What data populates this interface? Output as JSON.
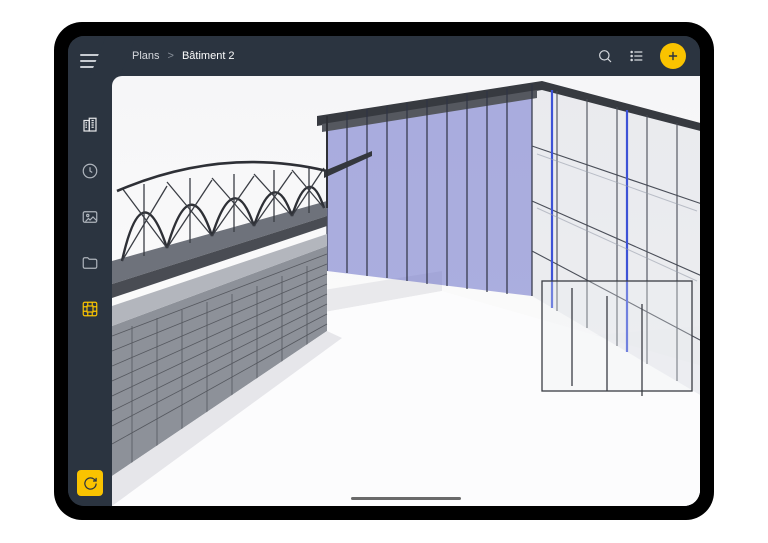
{
  "breadcrumb": {
    "root": "Plans",
    "separator": ">",
    "current": "Bâtiment 2"
  },
  "sidebar": {
    "items": [
      {
        "name": "buildings"
      },
      {
        "name": "history"
      },
      {
        "name": "photos"
      },
      {
        "name": "files"
      },
      {
        "name": "bim"
      }
    ]
  },
  "colors": {
    "accent": "#fac300",
    "panel": "#2b3440",
    "glass_blue": "#5a6fd8",
    "steel_dark": "#44474d",
    "steel_mid": "#7c8089"
  }
}
